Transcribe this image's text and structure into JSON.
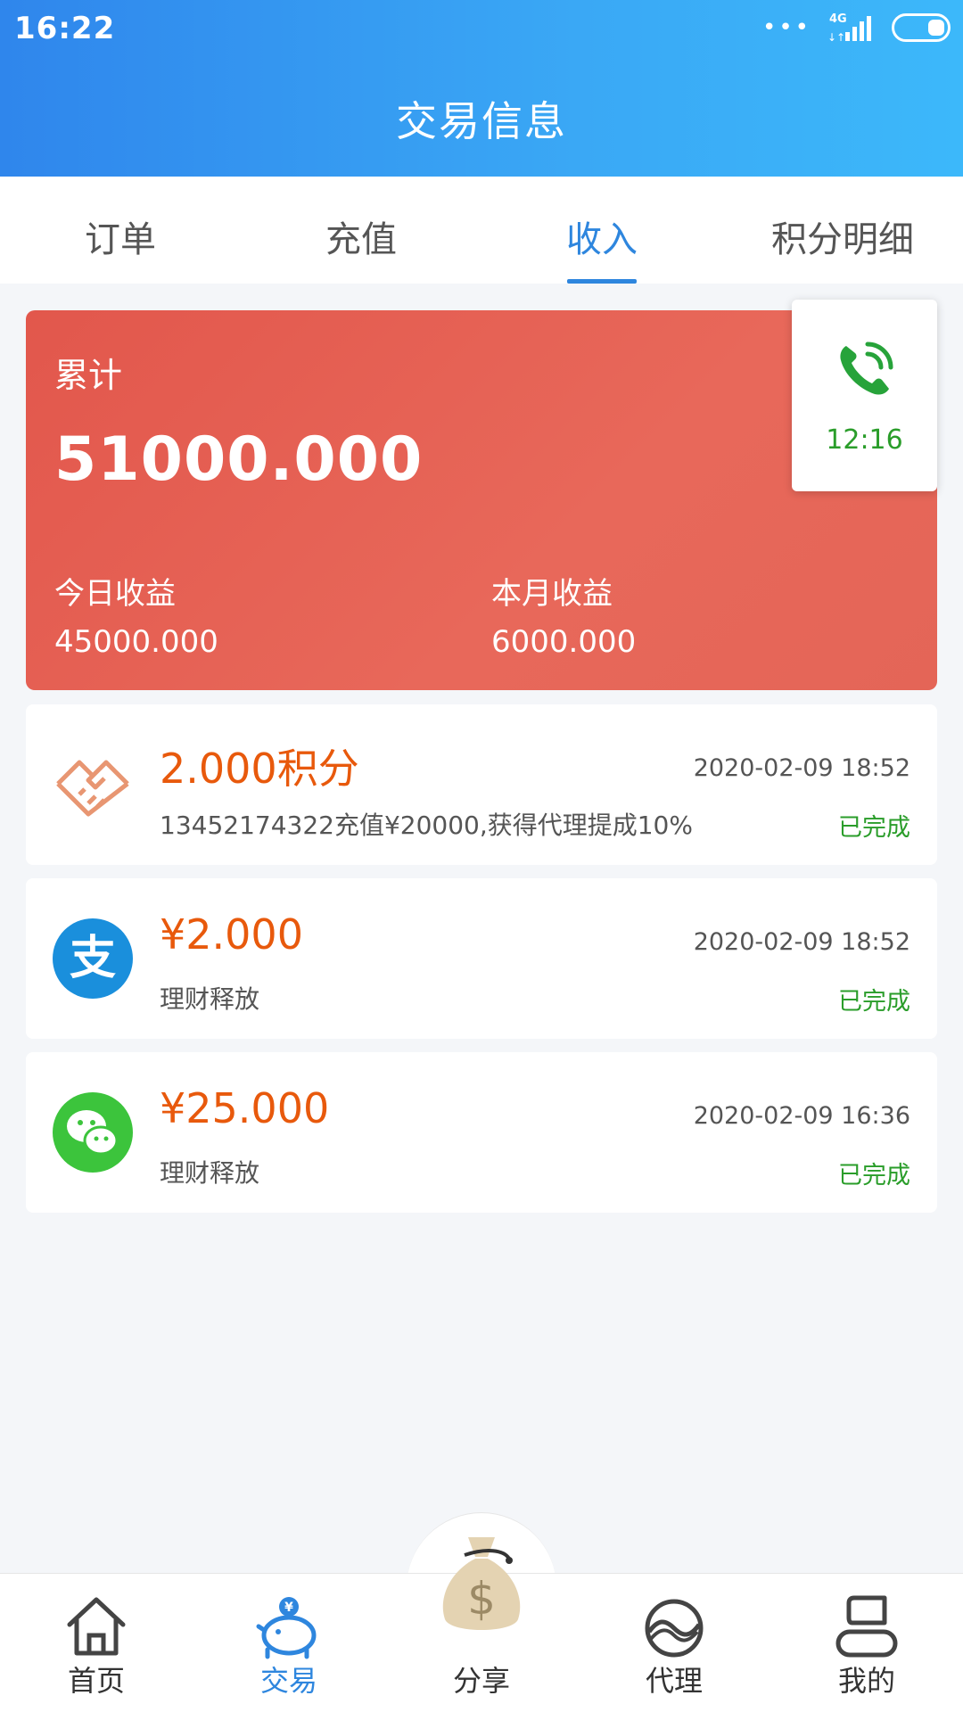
{
  "status_bar": {
    "time": "16:22",
    "network": "4G"
  },
  "header": {
    "title": "交易信息"
  },
  "tabs": [
    {
      "label": "订单",
      "active": false
    },
    {
      "label": "充值",
      "active": false
    },
    {
      "label": "收入",
      "active": true
    },
    {
      "label": "积分明细",
      "active": false
    }
  ],
  "summary": {
    "label": "累计",
    "total": "51000.000",
    "today_label": "今日收益",
    "today_value": "45000.000",
    "month_label": "本月收益",
    "month_value": "6000.000"
  },
  "call_widget": {
    "time": "12:16"
  },
  "transactions": [
    {
      "icon": "handshake-icon",
      "amount": "2.000积分",
      "description": "13452174322充值¥20000,获得代理提成10%",
      "time": "2020-02-09 18:52",
      "status": "已完成"
    },
    {
      "icon": "alipay-icon",
      "amount": "¥2.000",
      "description": "理财释放",
      "time": "2020-02-09 18:52",
      "status": "已完成"
    },
    {
      "icon": "wechat-icon",
      "amount": "¥25.000",
      "description": "理财释放",
      "time": "2020-02-09 16:36",
      "status": "已完成"
    }
  ],
  "bottom_nav": [
    {
      "label": "首页",
      "icon": "home-icon",
      "active": false
    },
    {
      "label": "交易",
      "icon": "piggy-bank-icon",
      "active": true
    },
    {
      "label": "分享",
      "icon": "money-bag-icon",
      "active": false
    },
    {
      "label": "代理",
      "icon": "agent-icon",
      "active": false
    },
    {
      "label": "我的",
      "icon": "profile-icon",
      "active": false
    }
  ],
  "colors": {
    "accent": "#2e86de",
    "summary_bg": "#e45e51",
    "amount": "#e8590c",
    "status_done": "#2a9d2a"
  }
}
